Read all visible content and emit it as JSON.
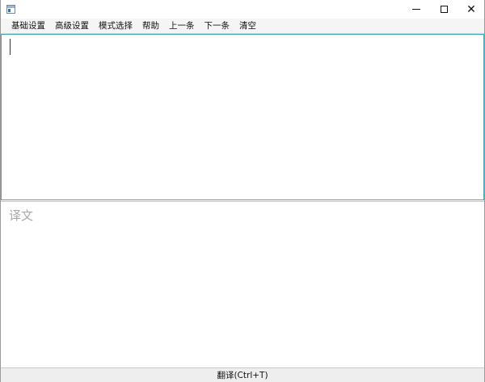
{
  "window": {
    "icon": "app-window-icon",
    "controls": {
      "minimize_icon": "minimize-icon",
      "maximize_icon": "maximize-icon",
      "close_icon": "close-icon",
      "close_glyph": "✕"
    }
  },
  "menu": {
    "items": [
      "基础设置",
      "高级设置",
      "模式选择",
      "帮助",
      "上一条",
      "下一条",
      "清空"
    ]
  },
  "source": {
    "value": "",
    "border_color": "#3da6c0"
  },
  "target": {
    "placeholder": "译文"
  },
  "translate_button": {
    "label": "翻译(Ctrl+T)"
  }
}
